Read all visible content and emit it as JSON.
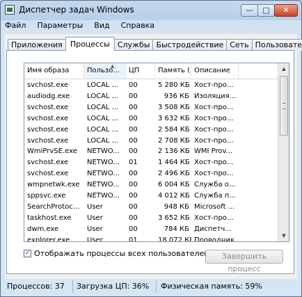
{
  "window": {
    "title": "Диспетчер задач Windows",
    "buttons": {
      "minimize": "—",
      "maximize": "□",
      "close": "✕"
    }
  },
  "menu": [
    "Файл",
    "Параметры",
    "Вид",
    "Справка"
  ],
  "tabs": [
    {
      "label": "Приложения",
      "active": false
    },
    {
      "label": "Процессы",
      "active": true
    },
    {
      "label": "Службы",
      "active": false
    },
    {
      "label": "Быстродействие",
      "active": false
    },
    {
      "label": "Сеть",
      "active": false
    },
    {
      "label": "Пользователи",
      "active": false
    }
  ],
  "table": {
    "columns": [
      "Имя образа",
      "Пользо...",
      "ЦП",
      "Память (...",
      "Описание"
    ],
    "rows": [
      [
        "svchost.exe",
        "LOCAL ...",
        "00",
        "5 280 КБ",
        "Хост-про..."
      ],
      [
        "audiodg.exe",
        "LOCAL ...",
        "00",
        "936 КБ",
        "Изоляция..."
      ],
      [
        "svchost.exe",
        "LOCAL ...",
        "00",
        "3 508 КБ",
        "Хост-про..."
      ],
      [
        "svchost.exe",
        "LOCAL ...",
        "00",
        "3 632 КБ",
        "Хост-про..."
      ],
      [
        "svchost.exe",
        "LOCAL ...",
        "00",
        "2 584 КБ",
        "Хост-про..."
      ],
      [
        "svchost.exe",
        "LOCAL ...",
        "00",
        "2 708 КБ",
        "Хост-про..."
      ],
      [
        "WmiPrvSE.exe",
        "NETWO...",
        "00",
        "2 136 КБ",
        "WMI Prov..."
      ],
      [
        "svchost.exe",
        "NETWO...",
        "01",
        "1 464 КБ",
        "Хост-про..."
      ],
      [
        "svchost.exe",
        "NETWO...",
        "00",
        "2 496 КБ",
        "Хост-про..."
      ],
      [
        "wmpnetwk.exe",
        "NETWO...",
        "00",
        "6 004 КБ",
        "Служба о..."
      ],
      [
        "sppsvc.exe",
        "NETWO...",
        "00",
        "4 012 КБ",
        "Служба п..."
      ],
      [
        "SearchProtoc...",
        "User",
        "00",
        "948 КБ",
        "Microsoft ..."
      ],
      [
        "taskhost.exe",
        "User",
        "00",
        "3 652 КБ",
        "Хост-про..."
      ],
      [
        "dwm.exe",
        "User",
        "00",
        "784 КБ",
        "Диспетч..."
      ],
      [
        "explorer.exe",
        "User",
        "01",
        "18 072 КБ",
        "Проводник"
      ]
    ]
  },
  "show_all_users": {
    "label": "Отображать процессы всех пользователей",
    "checked": true
  },
  "end_process_button": "Завершить процесс",
  "status": {
    "processes": "Процессов: 37",
    "cpu": "Загрузка ЦП: 36%",
    "memory": "Физическая память: 59%"
  }
}
